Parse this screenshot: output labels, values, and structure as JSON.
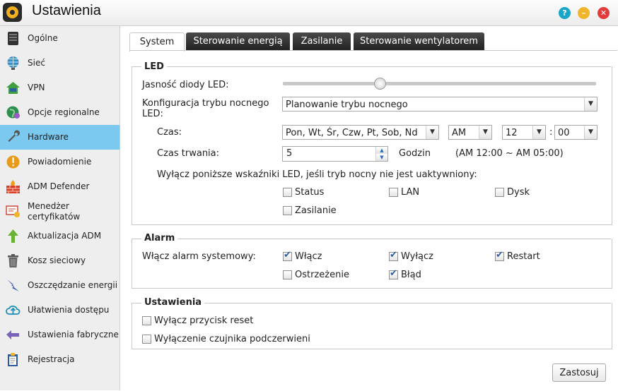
{
  "window": {
    "title": "Ustawienia"
  },
  "sidebar": {
    "items": [
      {
        "label": "Ogólne"
      },
      {
        "label": "Sieć"
      },
      {
        "label": "VPN"
      },
      {
        "label": "Opcje regionalne"
      },
      {
        "label": "Hardware"
      },
      {
        "label": "Powiadomienie"
      },
      {
        "label": "ADM Defender"
      },
      {
        "label": "Menedżer",
        "label2": "certyfikatów"
      },
      {
        "label": "Aktualizacja ADM"
      },
      {
        "label": "Kosz sieciowy"
      },
      {
        "label": "Oszczędzanie energii"
      },
      {
        "label": "Ułatwienia dostępu"
      },
      {
        "label": "Ustawienia fabryczne"
      },
      {
        "label": "Rejestracja"
      }
    ]
  },
  "tabs": [
    {
      "label": "System"
    },
    {
      "label": "Sterowanie energią"
    },
    {
      "label": "Zasilanie"
    },
    {
      "label": "Sterowanie wentylatorem"
    }
  ],
  "led": {
    "section_title": "LED",
    "brightness_label": "Jasność diody LED:",
    "brightness_level": 0.31,
    "night_mode_label1": "Konfiguracja trybu nocnego",
    "night_mode_label2": "LED:",
    "night_mode_value": "Planowanie trybu nocnego",
    "time_label": "Czas:",
    "days_value": "Pon, Wt, Śr, Czw, Pt, Sob, Nd",
    "ampm_value": "AM",
    "hour_value": "12",
    "colon": ":",
    "minute_value": "00",
    "duration_label": "Czas trwania:",
    "duration_value": "5",
    "duration_unit": "Godzin",
    "duration_range": "(AM 12:00 ~ AM 05:00)",
    "disable_note": "Wyłącz poniższe wskaźniki LED, jeśli tryb nocny nie jest uaktywniony:",
    "checks": [
      {
        "label": "Status",
        "checked": false
      },
      {
        "label": "LAN",
        "checked": false
      },
      {
        "label": "Dysk",
        "checked": false
      },
      {
        "label": "Zasilanie",
        "checked": false
      }
    ]
  },
  "alarm": {
    "section_title": "Alarm",
    "enable_label": "Włącz alarm systemowy:",
    "checks": [
      {
        "label": "Włącz",
        "checked": true
      },
      {
        "label": "Wyłącz",
        "checked": true
      },
      {
        "label": "Restart",
        "checked": true
      },
      {
        "label": "Ostrzeżenie",
        "checked": false
      },
      {
        "label": "Błąd",
        "checked": true
      }
    ]
  },
  "settings": {
    "section_title": "Ustawienia",
    "checks": [
      {
        "label": "Wyłącz przycisk reset",
        "checked": false
      },
      {
        "label": "Wyłączenie czujnika podczerwieni",
        "checked": false
      }
    ]
  },
  "apply_button": "Zastosuj"
}
